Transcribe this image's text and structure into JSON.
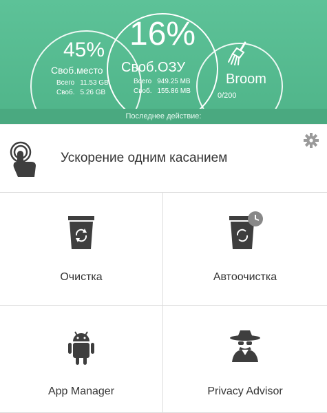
{
  "header": {
    "storage": {
      "percent": "45%",
      "label": "Своб.место",
      "total_label": "Всего",
      "total_value": "11.53 GB",
      "free_label": "Своб.",
      "free_value": "5.26 GB"
    },
    "ram": {
      "percent": "16%",
      "label": "Своб.ОЗУ",
      "total_label": "Всего",
      "total_value": "949.25 MB",
      "free_label": "Своб.",
      "free_value": "155.86 MB"
    },
    "broom": {
      "label": "Broom",
      "count": "0/200"
    },
    "last_action": "Последнее действие:"
  },
  "boost": {
    "label": "Ускорение одним касанием"
  },
  "tiles": [
    {
      "label": "Очистка"
    },
    {
      "label": "Автоочистка"
    },
    {
      "label": "App Manager"
    },
    {
      "label": "Privacy Advisor"
    }
  ],
  "colors": {
    "accent": "#5dc298",
    "icon": "#3e3e3e"
  }
}
